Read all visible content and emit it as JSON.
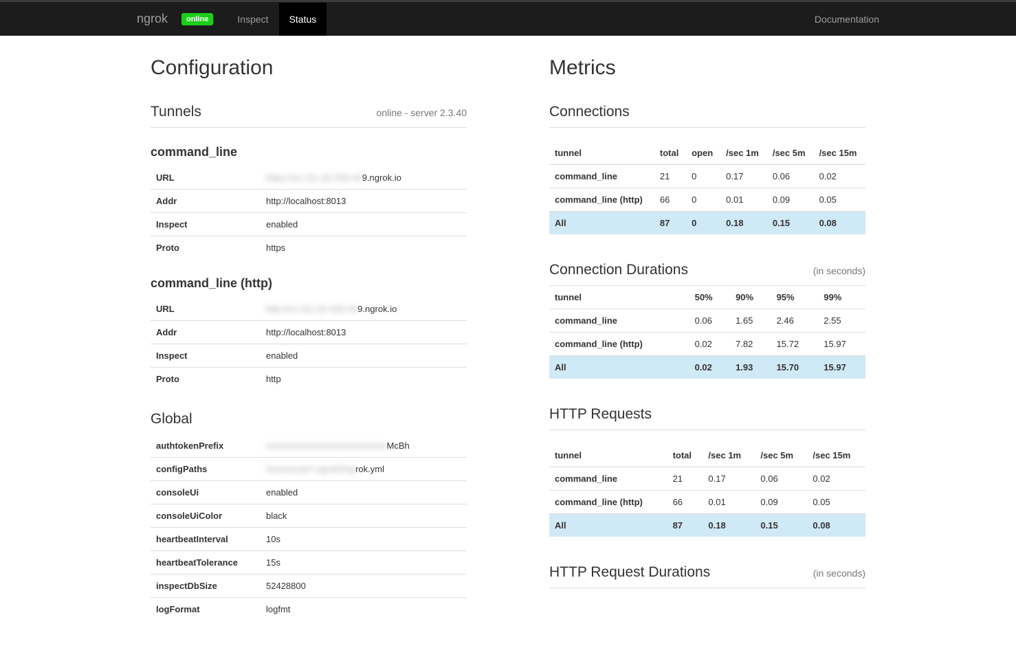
{
  "nav": {
    "brand": "ngrok",
    "statusBadge": "online",
    "inspect": "Inspect",
    "status": "Status",
    "docs": "Documentation"
  },
  "config": {
    "title": "Configuration",
    "tunnels": {
      "title": "Tunnels",
      "status": "online - server 2.3.40"
    },
    "tunnel1": {
      "name": "command_line",
      "rows": [
        {
          "k": "URL",
          "vPrefix": "https://xx-111-22-333-44",
          "vSuffix": "9.ngrok.io"
        },
        {
          "k": "Addr",
          "v": "http://localhost:8013"
        },
        {
          "k": "Inspect",
          "v": "enabled"
        },
        {
          "k": "Proto",
          "v": "https"
        }
      ]
    },
    "tunnel2": {
      "name": "command_line (http)",
      "rows": [
        {
          "k": "URL",
          "vPrefix": "http://xx-111-22-333-44",
          "vSuffix": "9.ngrok.io"
        },
        {
          "k": "Addr",
          "v": "http://localhost:8013"
        },
        {
          "k": "Inspect",
          "v": "enabled"
        },
        {
          "k": "Proto",
          "v": "http"
        }
      ]
    },
    "global": {
      "title": "Global",
      "rows": [
        {
          "k": "authtokenPrefix",
          "vPrefix": "xxxxxxxxxxxxxxxxxxxxxxxxxxx",
          "vSuffix": "McBh"
        },
        {
          "k": "configPaths",
          "vPrefix": "/home/user/.ngrok2/ng",
          "vSuffix": "rok.yml"
        },
        {
          "k": "consoleUi",
          "v": "enabled"
        },
        {
          "k": "consoleUiColor",
          "v": "black"
        },
        {
          "k": "heartbeatInterval",
          "v": "10s"
        },
        {
          "k": "heartbeatTolerance",
          "v": "15s"
        },
        {
          "k": "inspectDbSize",
          "v": "52428800"
        },
        {
          "k": "logFormat",
          "v": "logfmt"
        }
      ]
    }
  },
  "metrics": {
    "title": "Metrics",
    "connections": {
      "title": "Connections",
      "headers": [
        "tunnel",
        "total",
        "open",
        "/sec 1m",
        "/sec 5m",
        "/sec 15m"
      ],
      "rows": [
        {
          "tunnel": "command_line",
          "vals": [
            "21",
            "0",
            "0.17",
            "0.06",
            "0.02"
          ]
        },
        {
          "tunnel": "command_line (http)",
          "vals": [
            "66",
            "0",
            "0.01",
            "0.09",
            "0.05"
          ]
        }
      ],
      "all": {
        "tunnel": "All",
        "vals": [
          "87",
          "0",
          "0.18",
          "0.15",
          "0.08"
        ]
      }
    },
    "durations": {
      "title": "Connection Durations",
      "sub": "(in seconds)",
      "headers": [
        "tunnel",
        "50%",
        "90%",
        "95%",
        "99%"
      ],
      "rows": [
        {
          "tunnel": "command_line",
          "vals": [
            "0.06",
            "1.65",
            "2.46",
            "2.55"
          ]
        },
        {
          "tunnel": "command_line (http)",
          "vals": [
            "0.02",
            "7.82",
            "15.72",
            "15.97"
          ]
        }
      ],
      "all": {
        "tunnel": "All",
        "vals": [
          "0.02",
          "1.93",
          "15.70",
          "15.97"
        ]
      }
    },
    "http": {
      "title": "HTTP Requests",
      "headers": [
        "tunnel",
        "total",
        "/sec 1m",
        "/sec 5m",
        "/sec 15m"
      ],
      "rows": [
        {
          "tunnel": "command_line",
          "vals": [
            "21",
            "0.17",
            "0.06",
            "0.02"
          ]
        },
        {
          "tunnel": "command_line (http)",
          "vals": [
            "66",
            "0.01",
            "0.09",
            "0.05"
          ]
        }
      ],
      "all": {
        "tunnel": "All",
        "vals": [
          "87",
          "0.18",
          "0.15",
          "0.08"
        ]
      }
    },
    "httpDur": {
      "title": "HTTP Request Durations",
      "sub": "(in seconds)"
    }
  }
}
